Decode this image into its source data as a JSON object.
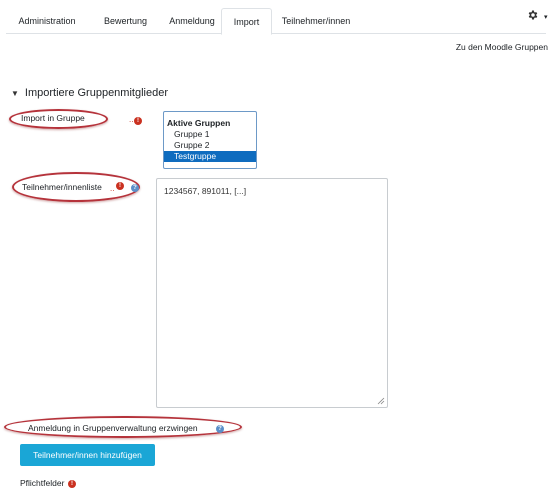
{
  "tabs": [
    {
      "label": "Administration"
    },
    {
      "label": "Bewertung"
    },
    {
      "label": "Anmeldung"
    },
    {
      "label": "Import",
      "active": true
    },
    {
      "label": "Teilnehmer/innen"
    }
  ],
  "header": {
    "settings_icon": "gear-icon",
    "settings_caret": "▾"
  },
  "moodle_groups_link": "Zu den Moodle Gruppen",
  "section": {
    "title": "Importiere Gruppenmitglieder",
    "toggle_icon": "▼"
  },
  "import_group": {
    "label": "Import in Gruppe",
    "select": {
      "group_label": "Aktive Gruppen",
      "options": [
        "Gruppe 1",
        "Gruppe 2",
        "Testgruppe"
      ],
      "selected": "Testgruppe"
    }
  },
  "participants": {
    "label": "Teilnehmer/innenliste",
    "value": "1234567, 891011, [...]"
  },
  "force_registration": {
    "label": "Anmeldung in Gruppenverwaltung erzwingen"
  },
  "submit_button": {
    "label": "Teilnehmer/innen hinzufügen"
  },
  "required_fields": {
    "label": "Pflichtfelder"
  },
  "colors": {
    "accent": "#1aa6d6",
    "required": "#ca3120",
    "highlight_oval": "#b5333b",
    "selected_option": "#0f6cbf"
  }
}
